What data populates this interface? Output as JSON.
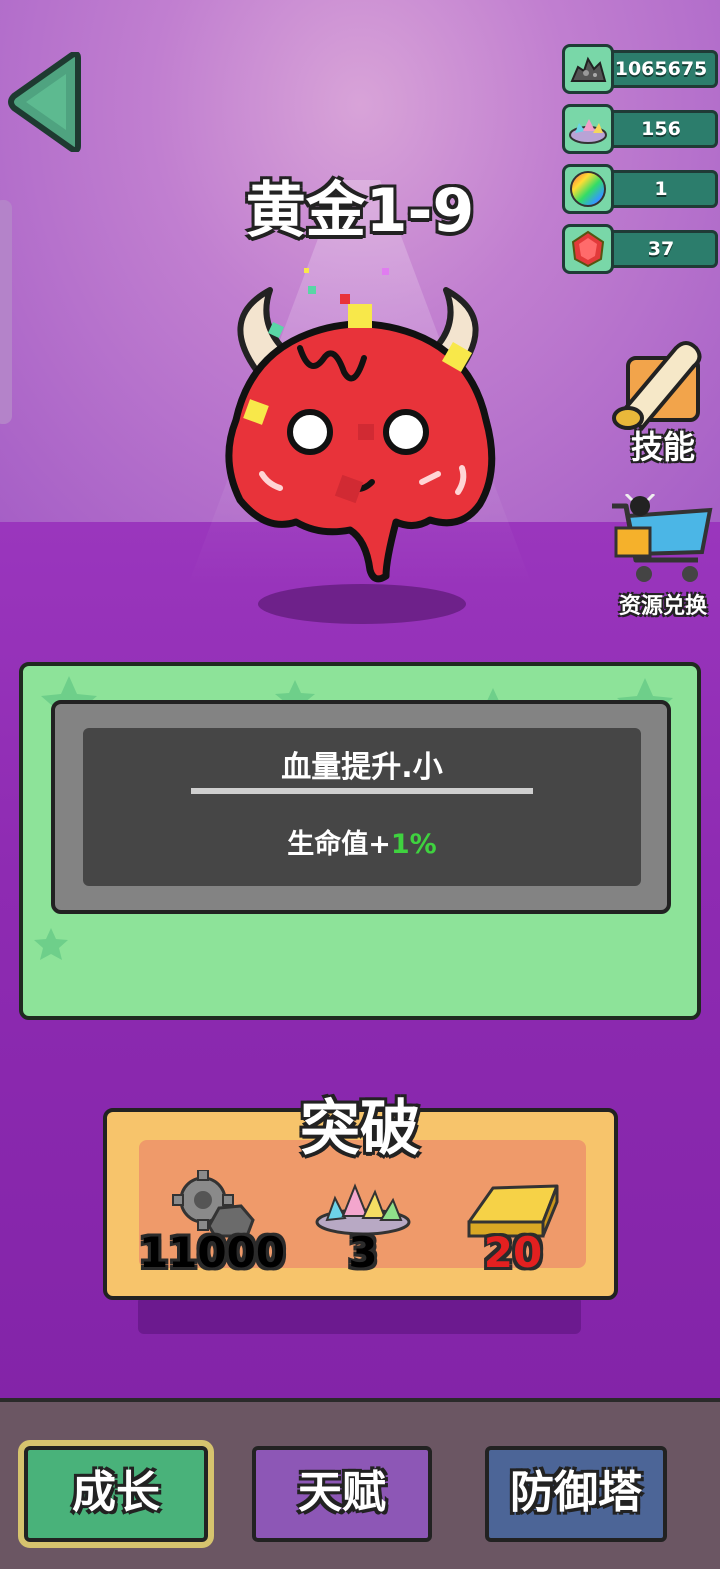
{
  "stage": {
    "title": "黄金1-9"
  },
  "resources": [
    {
      "icon": "scrap-pile-icon",
      "value": "1065675"
    },
    {
      "icon": "gem-pile-icon",
      "value": "156"
    },
    {
      "icon": "rainbow-orb-icon",
      "value": "1"
    },
    {
      "icon": "red-crystal-icon",
      "value": "37"
    }
  ],
  "side_buttons": {
    "skills_label": "技能",
    "exchange_label": "资源兑换"
  },
  "upgrade": {
    "name": "血量提升.小",
    "effect_prefix": "生命值+",
    "effect_value": "1%"
  },
  "breakthrough": {
    "title": "突破",
    "costs": [
      {
        "icon": "gear-ore-icon",
        "value": "11000",
        "color": "#ffffff"
      },
      {
        "icon": "crystal-pile-icon",
        "value": "3",
        "color": "#ffffff"
      },
      {
        "icon": "gold-bar-icon",
        "value": "20",
        "color": "#e32020"
      }
    ]
  },
  "tabs": [
    {
      "label": "成长",
      "active": true
    },
    {
      "label": "天赋",
      "active": false
    },
    {
      "label": "防御塔",
      "active": false
    }
  ]
}
